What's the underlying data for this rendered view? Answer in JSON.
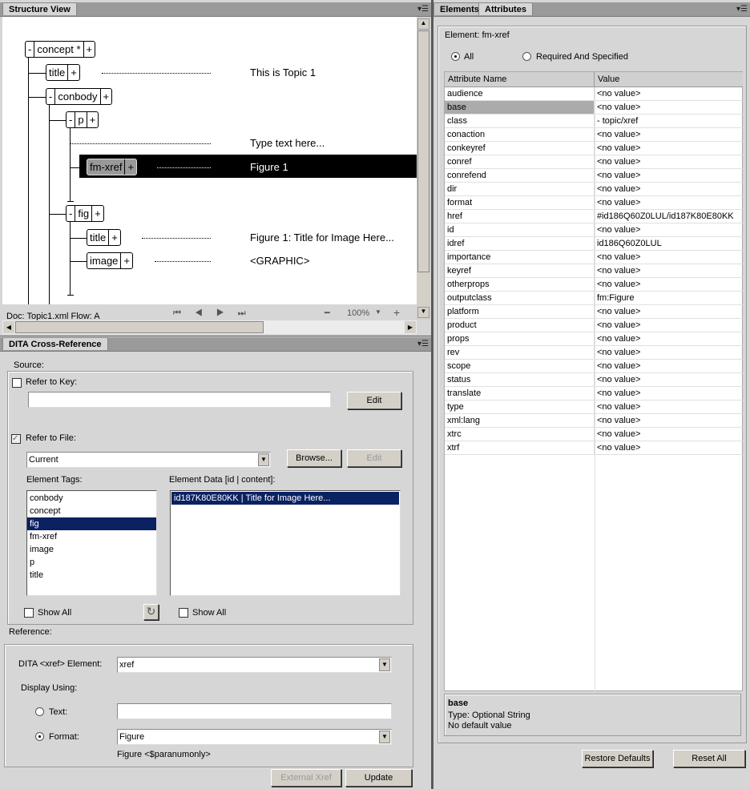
{
  "structure": {
    "tab": "Structure View",
    "status": "Doc: Topic1.xml Flow: A",
    "zoom": "100%",
    "nodes": {
      "concept": "concept *",
      "title": "title",
      "conbody": "conbody",
      "p": "p",
      "fmxref": "fm-xref",
      "fig": "fig",
      "figtitle": "title",
      "image": "image",
      "minus": "-",
      "plus": "+"
    },
    "content": {
      "title": "This is Topic 1",
      "p": "Type text here...",
      "fmxref": "Figure 1",
      "figtitle": "Figure 1: Title for Image Here...",
      "image": "<GRAPHIC>"
    }
  },
  "xref": {
    "tab": "DITA Cross-Reference",
    "source": "Source:",
    "refer_key": "Refer to Key:",
    "key_value": "",
    "edit": "Edit",
    "refer_file": "Refer to File:",
    "file": "Current",
    "browse": "Browse...",
    "edit2": "Edit",
    "tags_label": "Element Tags:",
    "tags": [
      "conbody",
      "concept",
      "fig",
      "fm-xref",
      "image",
      "p",
      "title"
    ],
    "selected_tag": "fig",
    "data_label": "Element Data [id | content]:",
    "data_items": [
      "id187K80E80KK | Title for Image Here..."
    ],
    "show_all": "Show All",
    "show_all2": "Show All",
    "reference": "Reference:",
    "xref_elem_label": "DITA <xref> Element:",
    "xref_elem": "xref",
    "display_using": "Display Using:",
    "text_label": "Text:",
    "text_value": "",
    "format_label": "Format:",
    "format": "Figure",
    "format_preview": "Figure <$paranumonly>",
    "external": "External Xref",
    "update": "Update"
  },
  "attrs": {
    "tabs": [
      "Elements",
      "Attributes"
    ],
    "element": "Element: fm-xref",
    "radio_all": "All",
    "radio_req": "Required And Specified",
    "col_name": "Attribute Name",
    "col_value": "Value",
    "rows": [
      [
        "audience",
        "<no value>"
      ],
      [
        "base",
        "<no value>"
      ],
      [
        "class",
        "- topic/xref"
      ],
      [
        "conaction",
        "<no value>"
      ],
      [
        "conkeyref",
        "<no value>"
      ],
      [
        "conref",
        "<no value>"
      ],
      [
        "conrefend",
        "<no value>"
      ],
      [
        "dir",
        "<no value>"
      ],
      [
        "format",
        "<no value>"
      ],
      [
        "href",
        "#id186Q60Z0LUL/id187K80E80KK"
      ],
      [
        "id",
        "<no value>"
      ],
      [
        "idref",
        "id186Q60Z0LUL"
      ],
      [
        "importance",
        "<no value>"
      ],
      [
        "keyref",
        "<no value>"
      ],
      [
        "otherprops",
        "<no value>"
      ],
      [
        "outputclass",
        "fm:Figure"
      ],
      [
        "platform",
        "<no value>"
      ],
      [
        "product",
        "<no value>"
      ],
      [
        "props",
        "<no value>"
      ],
      [
        "rev",
        "<no value>"
      ],
      [
        "scope",
        "<no value>"
      ],
      [
        "status",
        "<no value>"
      ],
      [
        "translate",
        "<no value>"
      ],
      [
        "type",
        "<no value>"
      ],
      [
        "xml:lang",
        "<no value>"
      ],
      [
        "xtrc",
        "<no value>"
      ],
      [
        "xtrf",
        "<no value>"
      ]
    ],
    "selected_row": "base",
    "info_title": "base",
    "info_type": "Type: Optional String",
    "info_default": "No default value",
    "restore": "Restore Defaults",
    "reset": "Reset All"
  }
}
